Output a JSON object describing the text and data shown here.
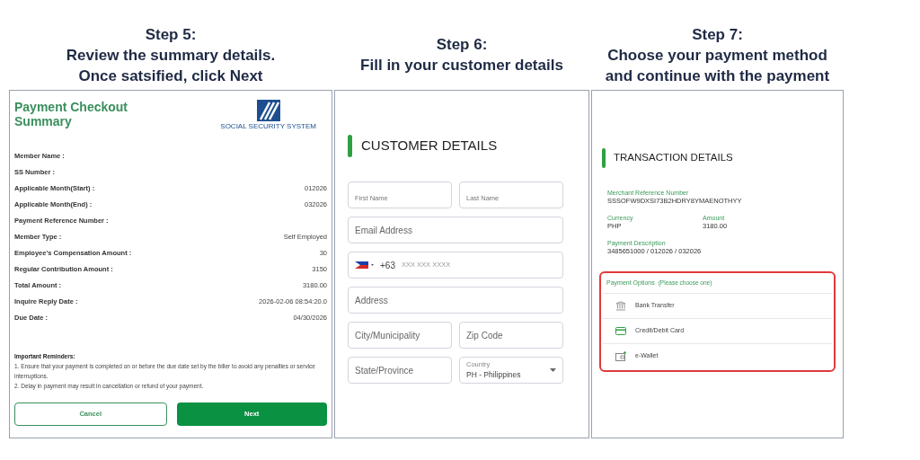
{
  "steps": [
    {
      "lines": [
        "Step 5:",
        "Review the summary details.",
        "Once satsified, click Next"
      ]
    },
    {
      "lines": [
        "Step 6:",
        "Fill in your customer details"
      ]
    },
    {
      "lines": [
        "Step 7:",
        "Choose your payment method",
        "and continue with the payment"
      ]
    }
  ],
  "summary": {
    "title": "Payment Checkout Summary",
    "logo_text": "SOCIAL SECURITY SYSTEM",
    "rows": [
      {
        "label": "Member Name :"
      },
      {
        "label": "SS Number :"
      },
      {
        "label": "Applicable Month(Start) :",
        "value": "012026"
      },
      {
        "label": "Applicable Month(End) :",
        "value": "032026"
      },
      {
        "label": "Payment Reference Number :"
      },
      {
        "label": "Member Type :",
        "value": "Self Employed"
      },
      {
        "label": "Employee's Compensation Amount :",
        "value": "30"
      },
      {
        "label": "Regular Contribution Amount :",
        "value": "3150"
      },
      {
        "label": "Total Amount :",
        "value": "3180.00"
      },
      {
        "label": "Inquire Reply Date :",
        "value": "2026-02-06 08:54:20.0"
      },
      {
        "label": "Due Date :",
        "value": "04/30/2026"
      }
    ],
    "reminders_title": "Important Reminders:",
    "reminders": [
      "1. Ensure that your payment is completed on or before the due date set by the biller to avoid any penalties or service interruptions.",
      "2. Delay in payment may result in cancellation or refund of your payment."
    ],
    "buttons": [
      {
        "label": "Cancel",
        "kind": "outline"
      },
      {
        "label": "Next",
        "kind": "primary"
      }
    ]
  },
  "customer": {
    "heading": "CUSTOMER DETAILS",
    "rows": [
      [
        {
          "kind": "floating",
          "label": "First Name"
        },
        {
          "kind": "floating",
          "label": "Last Name"
        }
      ],
      [
        {
          "kind": "plain",
          "placeholder": "Email Address"
        }
      ],
      [
        {
          "kind": "phone",
          "code": "+63",
          "placeholder": "XXX XXX XXXX"
        }
      ],
      [
        {
          "kind": "plain",
          "placeholder": "Address"
        }
      ],
      [
        {
          "kind": "plain",
          "placeholder": "City/Municipality"
        },
        {
          "kind": "plain",
          "placeholder": "Zip Code"
        }
      ],
      [
        {
          "kind": "plain",
          "placeholder": "State/Province"
        },
        {
          "kind": "select",
          "label": "Country",
          "value": "PH - Philippines"
        }
      ]
    ]
  },
  "transaction": {
    "heading": "TRANSACTION DETAILS",
    "fields": [
      [
        {
          "label": "Merchant Reference Number",
          "value": "SSSOFW9DXSI73B2HDRY8YMAENOTHYY"
        }
      ],
      [
        {
          "label": "Currency",
          "value": "PHP"
        },
        {
          "label": "Amount",
          "value": "3180.00"
        }
      ],
      [
        {
          "label": "Payment Description",
          "value": "3485651000 / 012026 / 032026"
        }
      ]
    ],
    "payment_options": {
      "title": "Payment Options",
      "hint": "(Please choose one)",
      "options": [
        {
          "kind": "bank",
          "label": "Bank Transfer"
        },
        {
          "kind": "card",
          "label": "Credit/Debit Card"
        },
        {
          "kind": "wallet",
          "label": "e-Wallet"
        }
      ]
    }
  }
}
